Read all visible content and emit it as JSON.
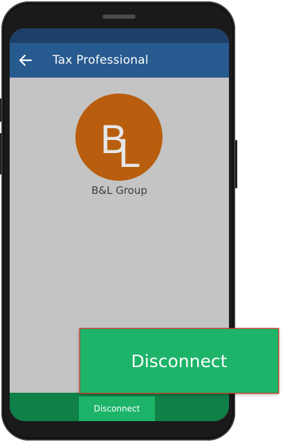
{
  "app_bar": {
    "title": "Tax Professional",
    "back_icon": "arrow-left-icon"
  },
  "profile": {
    "logo_text": "BL",
    "logo_color": "#b85e0e",
    "name": "B&L Group"
  },
  "bottom_bar": {
    "disconnect_label": "Disconnect"
  },
  "callout": {
    "disconnect_label": "Disconnect"
  },
  "colors": {
    "header": "#275a8e",
    "status_strip": "#1d4069",
    "screen_bg": "#c4c4c4",
    "bottom_bar": "#0e8048",
    "button": "#1db46a",
    "callout_border": "#b8442c"
  }
}
